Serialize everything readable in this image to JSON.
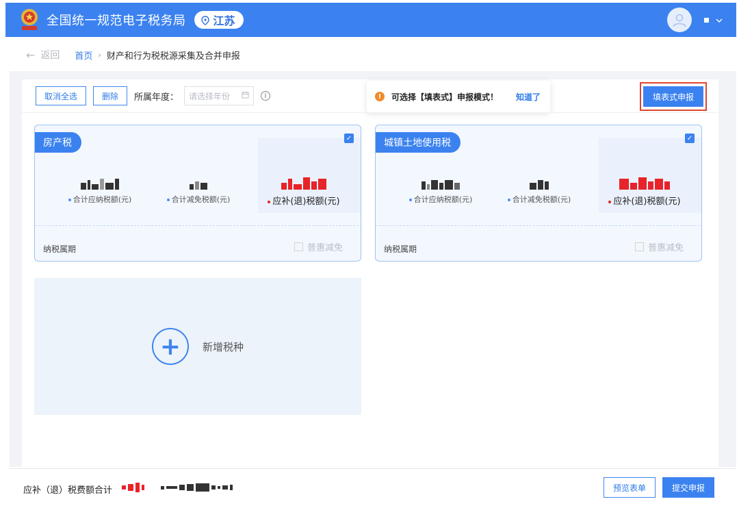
{
  "header": {
    "app_title": "全国统一规范电子税务局",
    "region": "江苏",
    "logo_icon": "tax-emblem-icon",
    "avatar_icon": "user-avatar-icon"
  },
  "breadcrumb": {
    "back": "返回",
    "home": "首页",
    "separator": "›",
    "current": "财产和行为税税源采集及合并申报"
  },
  "toolbar": {
    "deselect_all": "取消全选",
    "delete": "删除",
    "year_label": "所属年度：",
    "year_placeholder": "请选择年份",
    "info_glyph": "i"
  },
  "tooltip": {
    "warn_glyph": "!",
    "message": "可选择【填表式】申报模式！",
    "ack": "知道了"
  },
  "fill_form_button": "填表式申报",
  "cards": [
    {
      "tag": "房产税",
      "checked": true,
      "metrics": [
        {
          "label": "合计应纳税额(元)"
        },
        {
          "label": "合计减免税额(元)"
        },
        {
          "label": "应补(退)税额(元)"
        }
      ],
      "period_label": "纳税属期",
      "relief_label": "普惠减免"
    },
    {
      "tag": "城镇土地使用税",
      "checked": true,
      "metrics": [
        {
          "label": "合计应纳税额(元)"
        },
        {
          "label": "合计减免税额(元)"
        },
        {
          "label": "应补(退)税额(元)"
        }
      ],
      "period_label": "纳税属期",
      "relief_label": "普惠减免"
    }
  ],
  "add_tile": {
    "plus": "+",
    "label": "新增税种"
  },
  "footer": {
    "sum_label": "应补（退）税费额合计",
    "preview": "预览表单",
    "submit": "提交申报"
  },
  "colors": {
    "primary": "#3b82f0",
    "highlight_border": "#e0452d",
    "warning": "#f08a2a",
    "amount_red": "#e8232a"
  }
}
